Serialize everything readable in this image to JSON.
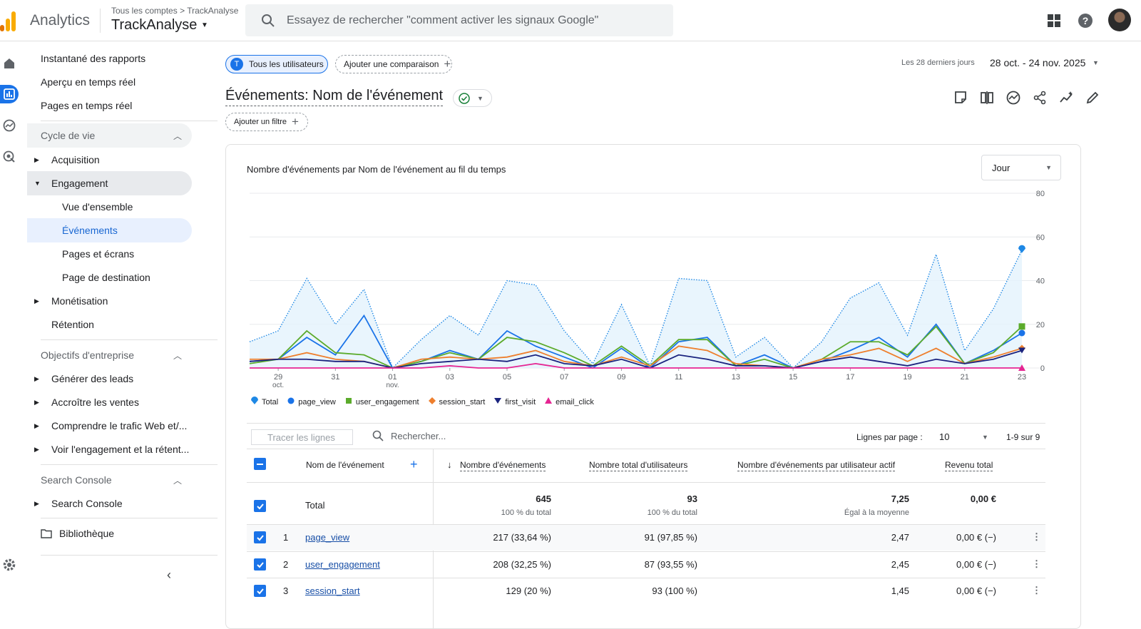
{
  "header": {
    "app_name": "Analytics",
    "crumb_root": "Tous les comptes",
    "crumb_sep": ">",
    "crumb_account": "TrackAnalyse",
    "account": "TrackAnalyse",
    "search_placeholder": "Essayez de rechercher \"comment activer les signaux Google\"",
    "icons": [
      "apps-icon",
      "help-icon",
      "avatar"
    ]
  },
  "rail": [
    "home-icon",
    "reports-icon",
    "explore-icon",
    "advertising-icon",
    "settings-icon"
  ],
  "nav": {
    "items": [
      {
        "label": "Instantané des rapports"
      },
      {
        "label": "Aperçu en temps réel"
      },
      {
        "label": "Pages en temps réel"
      },
      {
        "label": "Cycle de vie"
      },
      {
        "label": "Acquisition"
      },
      {
        "label": "Engagement"
      },
      {
        "label": "Vue d'ensemble"
      },
      {
        "label": "Événements"
      },
      {
        "label": "Pages et écrans"
      },
      {
        "label": "Page de destination"
      },
      {
        "label": "Monétisation"
      },
      {
        "label": "Rétention"
      },
      {
        "label": "Objectifs d'entreprise"
      },
      {
        "label": "Générer des leads"
      },
      {
        "label": "Accroître les ventes"
      },
      {
        "label": "Comprendre le trafic Web et/..."
      },
      {
        "label": "Voir l'engagement et la rétent..."
      },
      {
        "label": "Search Console"
      },
      {
        "label": "Search Console"
      },
      {
        "label": "Bibliothèque"
      }
    ]
  },
  "toolbar": {
    "segment_letter": "T",
    "segment": "Tous les utilisateurs",
    "add_comparison": "Ajouter une comparaison",
    "date_label": "Les 28 derniers jours",
    "date_value": "28 oct. - 24 nov. 2025",
    "title": "Événements: Nom de l'événement",
    "add_filter": "Ajouter un filtre"
  },
  "card": {
    "title": "Nombre d'événements par Nom de l'événement au fil du temps",
    "granularity": "Jour"
  },
  "colors": {
    "Total": "#1e88e5",
    "page_view": "#1a73e8",
    "user_engagement": "#5bab2b",
    "session_start": "#ee7f2d",
    "first_visit": "#1a237e",
    "email_click": "#e52592"
  },
  "chart_data": {
    "type": "line",
    "x": [
      "28 oct.",
      "29 oct.",
      "30 oct.",
      "31 oct.",
      "01 nov.",
      "02 nov.",
      "03 nov.",
      "04 nov.",
      "05 nov.",
      "06 nov.",
      "07 nov.",
      "08 nov.",
      "09 nov.",
      "10 nov.",
      "11 nov.",
      "12 nov.",
      "13 nov.",
      "14 nov.",
      "15 nov.",
      "16 nov.",
      "17 nov.",
      "18 nov.",
      "19 nov.",
      "20 nov.",
      "21 nov.",
      "22 nov.",
      "23 nov.",
      "24 nov."
    ],
    "x_tick_labels": [
      {
        "top": "29",
        "bottom": "oct."
      },
      {
        "top": "31",
        "bottom": ""
      },
      {
        "top": "01",
        "bottom": "nov."
      },
      {
        "top": "03",
        "bottom": ""
      },
      {
        "top": "05",
        "bottom": ""
      },
      {
        "top": "07",
        "bottom": ""
      },
      {
        "top": "09",
        "bottom": ""
      },
      {
        "top": "11",
        "bottom": ""
      },
      {
        "top": "13",
        "bottom": ""
      },
      {
        "top": "15",
        "bottom": ""
      },
      {
        "top": "17",
        "bottom": ""
      },
      {
        "top": "19",
        "bottom": ""
      },
      {
        "top": "21",
        "bottom": ""
      },
      {
        "top": "23",
        "bottom": ""
      }
    ],
    "y_ticks": [
      "0",
      "20",
      "40",
      "60",
      "80"
    ],
    "ylim": [
      0,
      80
    ],
    "grid": true,
    "legend_position": "bottom-left",
    "series": [
      {
        "name": "Total",
        "style": "dotted-area",
        "values": [
          12,
          17,
          41,
          20,
          36,
          0,
          13,
          24,
          15,
          40,
          38,
          17,
          2,
          29,
          1,
          41,
          40,
          5,
          14,
          0,
          12,
          32,
          39,
          15,
          52,
          8,
          27,
          54
        ]
      },
      {
        "name": "page_view",
        "values": [
          3,
          4,
          14,
          6,
          24,
          0,
          3,
          8,
          4,
          17,
          10,
          5,
          0,
          9,
          0,
          12,
          14,
          1,
          6,
          0,
          3,
          8,
          14,
          5,
          20,
          2,
          8,
          16
        ]
      },
      {
        "name": "user_engagement",
        "values": [
          2,
          4,
          17,
          7,
          6,
          0,
          3,
          7,
          4,
          14,
          12,
          7,
          1,
          10,
          1,
          13,
          13,
          1,
          4,
          0,
          4,
          12,
          12,
          6,
          19,
          2,
          7,
          19
        ]
      },
      {
        "name": "session_start",
        "values": [
          4,
          4,
          7,
          4,
          3,
          0,
          4,
          5,
          4,
          5,
          8,
          3,
          1,
          5,
          1,
          10,
          8,
          2,
          1,
          0,
          4,
          6,
          9,
          3,
          9,
          2,
          5,
          9
        ]
      },
      {
        "name": "first_visit",
        "values": [
          3,
          4,
          4,
          3,
          3,
          0,
          2,
          3,
          4,
          3,
          6,
          2,
          1,
          4,
          0,
          6,
          4,
          1,
          1,
          0,
          3,
          5,
          3,
          1,
          4,
          2,
          4,
          8
        ]
      },
      {
        "name": "email_click",
        "values": [
          0,
          0,
          0,
          0,
          0,
          0,
          0,
          1,
          0,
          0,
          2,
          0,
          0,
          0,
          0,
          0,
          0,
          0,
          0,
          0,
          0,
          0,
          0,
          0,
          0,
          0,
          0,
          0
        ]
      }
    ]
  },
  "table": {
    "trace_rows": "Tracer les lignes",
    "search_placeholder": "Rechercher...",
    "rows_per_page_label": "Lignes par page :",
    "rows_per_page": "10",
    "range": "1-9 sur 9",
    "headers": {
      "name": "Nom de l'événement",
      "events": "Nombre d'événements",
      "users": "Nombre total d'utilisateurs",
      "per_user": "Nombre d'événements par utilisateur actif",
      "revenue": "Revenu total"
    },
    "total": {
      "label": "Total",
      "events": "645",
      "events_sub": "100 % du total",
      "users": "93",
      "users_sub": "100 % du total",
      "per_user": "7,25",
      "per_user_sub": "Égal à la moyenne",
      "revenue": "0,00 €"
    },
    "rows": [
      {
        "rank": "1",
        "name": "page_view",
        "events": "217 (33,64 %)",
        "users": "91 (97,85 %)",
        "per_user": "2,47",
        "revenue": "0,00 € (−)"
      },
      {
        "rank": "2",
        "name": "user_engagement",
        "events": "208 (32,25 %)",
        "users": "87 (93,55 %)",
        "per_user": "2,45",
        "revenue": "0,00 € (−)"
      },
      {
        "rank": "3",
        "name": "session_start",
        "events": "129 (20 %)",
        "users": "93 (100 %)",
        "per_user": "1,45",
        "revenue": "0,00 € (−)"
      }
    ]
  }
}
